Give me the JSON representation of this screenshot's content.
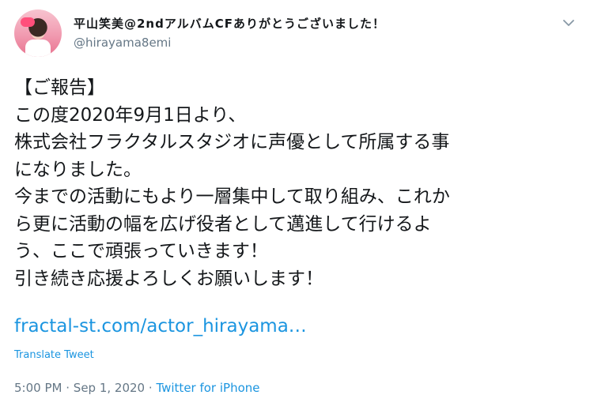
{
  "author": {
    "display_name": "平山笑美@2ndアルバムCFありがとうございました！",
    "handle": "@hirayama8emi"
  },
  "icons": {
    "more": "chevron-down-icon",
    "avatar": "avatar"
  },
  "tweet": {
    "lines": [
      "【ご報告】",
      "この度2020年9月1日より、",
      "株式会社フラクタルスタジオに声優として所属する事",
      "になりました。",
      "今までの活動にもより一層集中して取り組み、これか",
      "ら更に活動の幅を広げ役者として邁進して行けるよ",
      "う、ここで頑張っていきます！",
      "引き続き応援よろしくお願いします！"
    ],
    "link": "fractal-st.com/actor_hirayama…",
    "translate_label": "Translate Tweet",
    "time": "5:00 PM",
    "date": "Sep 1, 2020",
    "separator": "·",
    "source": "Twitter for iPhone"
  },
  "colors": {
    "link": "#1b95e0",
    "muted": "#657786",
    "text": "#14171a"
  }
}
